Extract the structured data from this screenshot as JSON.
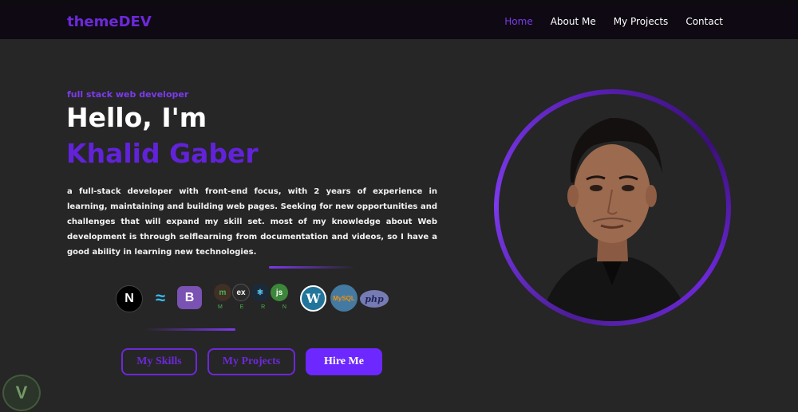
{
  "header": {
    "brand": "themeDEV",
    "nav": [
      "Home",
      "About Me",
      "My Projects",
      "Contact"
    ],
    "active_index": 0
  },
  "hero": {
    "subtitle": "full stack web developer",
    "greeting": "Hello, I'm",
    "name": "Khalid Gaber",
    "description": "a full-stack developer with front-end focus, with 2 years of experience in learning, maintaining and building web pages. Seeking for new opportunities and challenges that will expand my skill set. most of my knowledge about Web development is through selflearning from documentation and videos, so I have a good ability in learning new technologies."
  },
  "tech_icons": {
    "next": "N",
    "bootstrap": "B",
    "mern_letters": [
      "M",
      "E",
      "R",
      "N"
    ],
    "mern_labels": [
      "m",
      "ex",
      "⚛",
      "js"
    ],
    "wordpress": "W",
    "mysql": "MySQL",
    "php": "php"
  },
  "buttons": {
    "skills": "My Skills",
    "projects": "My Projects",
    "hire": "Hire Me"
  },
  "colors": {
    "accent": "#6d28d9",
    "background": "#262626",
    "navbar": "#0e0913"
  }
}
